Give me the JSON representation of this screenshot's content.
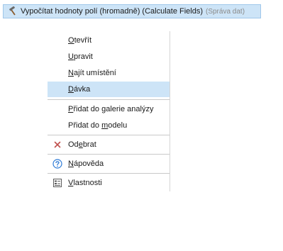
{
  "tool": {
    "name": "Vypočítat hodnoty polí (hromadně) (Calculate Fields)",
    "toolbox": "(Správa dat)",
    "icon": "hammer-icon"
  },
  "menu": {
    "items": [
      {
        "id": "open",
        "pre": "",
        "u": "O",
        "post": "tevřít"
      },
      {
        "id": "edit",
        "pre": "",
        "u": "U",
        "post": "pravit"
      },
      {
        "id": "find",
        "pre": "",
        "u": "N",
        "post": "ajít umístění"
      },
      {
        "id": "batch",
        "pre": "",
        "u": "D",
        "post": "ávka"
      },
      {
        "id": "add-gallery",
        "pre": "",
        "u": "P",
        "post": "řidat do galerie analýzy"
      },
      {
        "id": "add-model",
        "pre": "Přidat do ",
        "u": "m",
        "post": "odelu"
      },
      {
        "id": "remove",
        "pre": "Od",
        "u": "e",
        "post": "brat"
      },
      {
        "id": "help",
        "pre": "",
        "u": "N",
        "post": "ápověda"
      },
      {
        "id": "properties",
        "pre": "",
        "u": "V",
        "post": "lastnosti"
      }
    ],
    "icons": {
      "remove": "close-icon",
      "help": "help-icon",
      "properties": "properties-icon"
    },
    "colors": {
      "highlight": "#cde4f7",
      "remove_icon": "#c0504d",
      "help_icon": "#2e7bd6"
    }
  }
}
